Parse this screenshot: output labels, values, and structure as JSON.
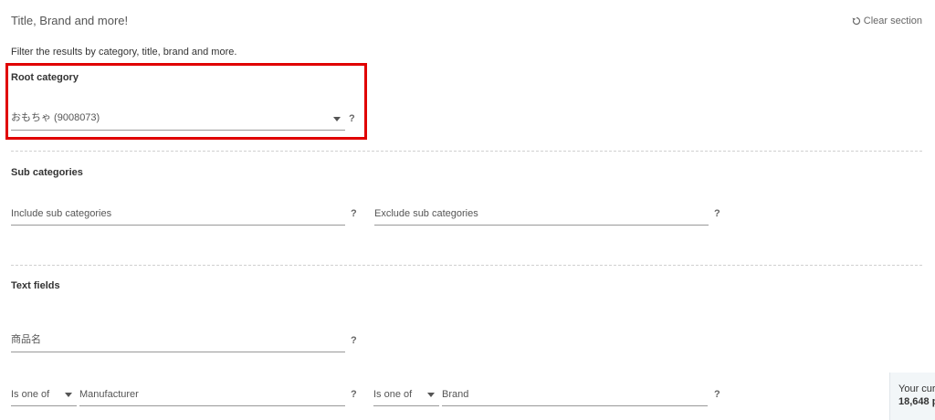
{
  "section": {
    "title": "Title, Brand and more!",
    "clear_label": "Clear section",
    "description": "Filter the results by category, title, brand and more."
  },
  "root_category": {
    "label": "Root category",
    "value": "おもちゃ (9008073)",
    "help": "?"
  },
  "sub_categories": {
    "label": "Sub categories",
    "include_placeholder": "Include sub categories",
    "exclude_placeholder": "Exclude sub categories",
    "help": "?"
  },
  "text_fields": {
    "label": "Text fields",
    "title_placeholder": "商品名",
    "help": "?",
    "manufacturer_operator": "Is one of",
    "manufacturer_placeholder": "Manufacturer",
    "brand_operator": "Is one of",
    "brand_placeholder": "Brand"
  },
  "side_panel": {
    "line1": "Your cur",
    "line2": "18,648 p"
  },
  "colors": {
    "highlight": "#e00000",
    "underline": "#999999",
    "divider": "#d0d0d0"
  }
}
